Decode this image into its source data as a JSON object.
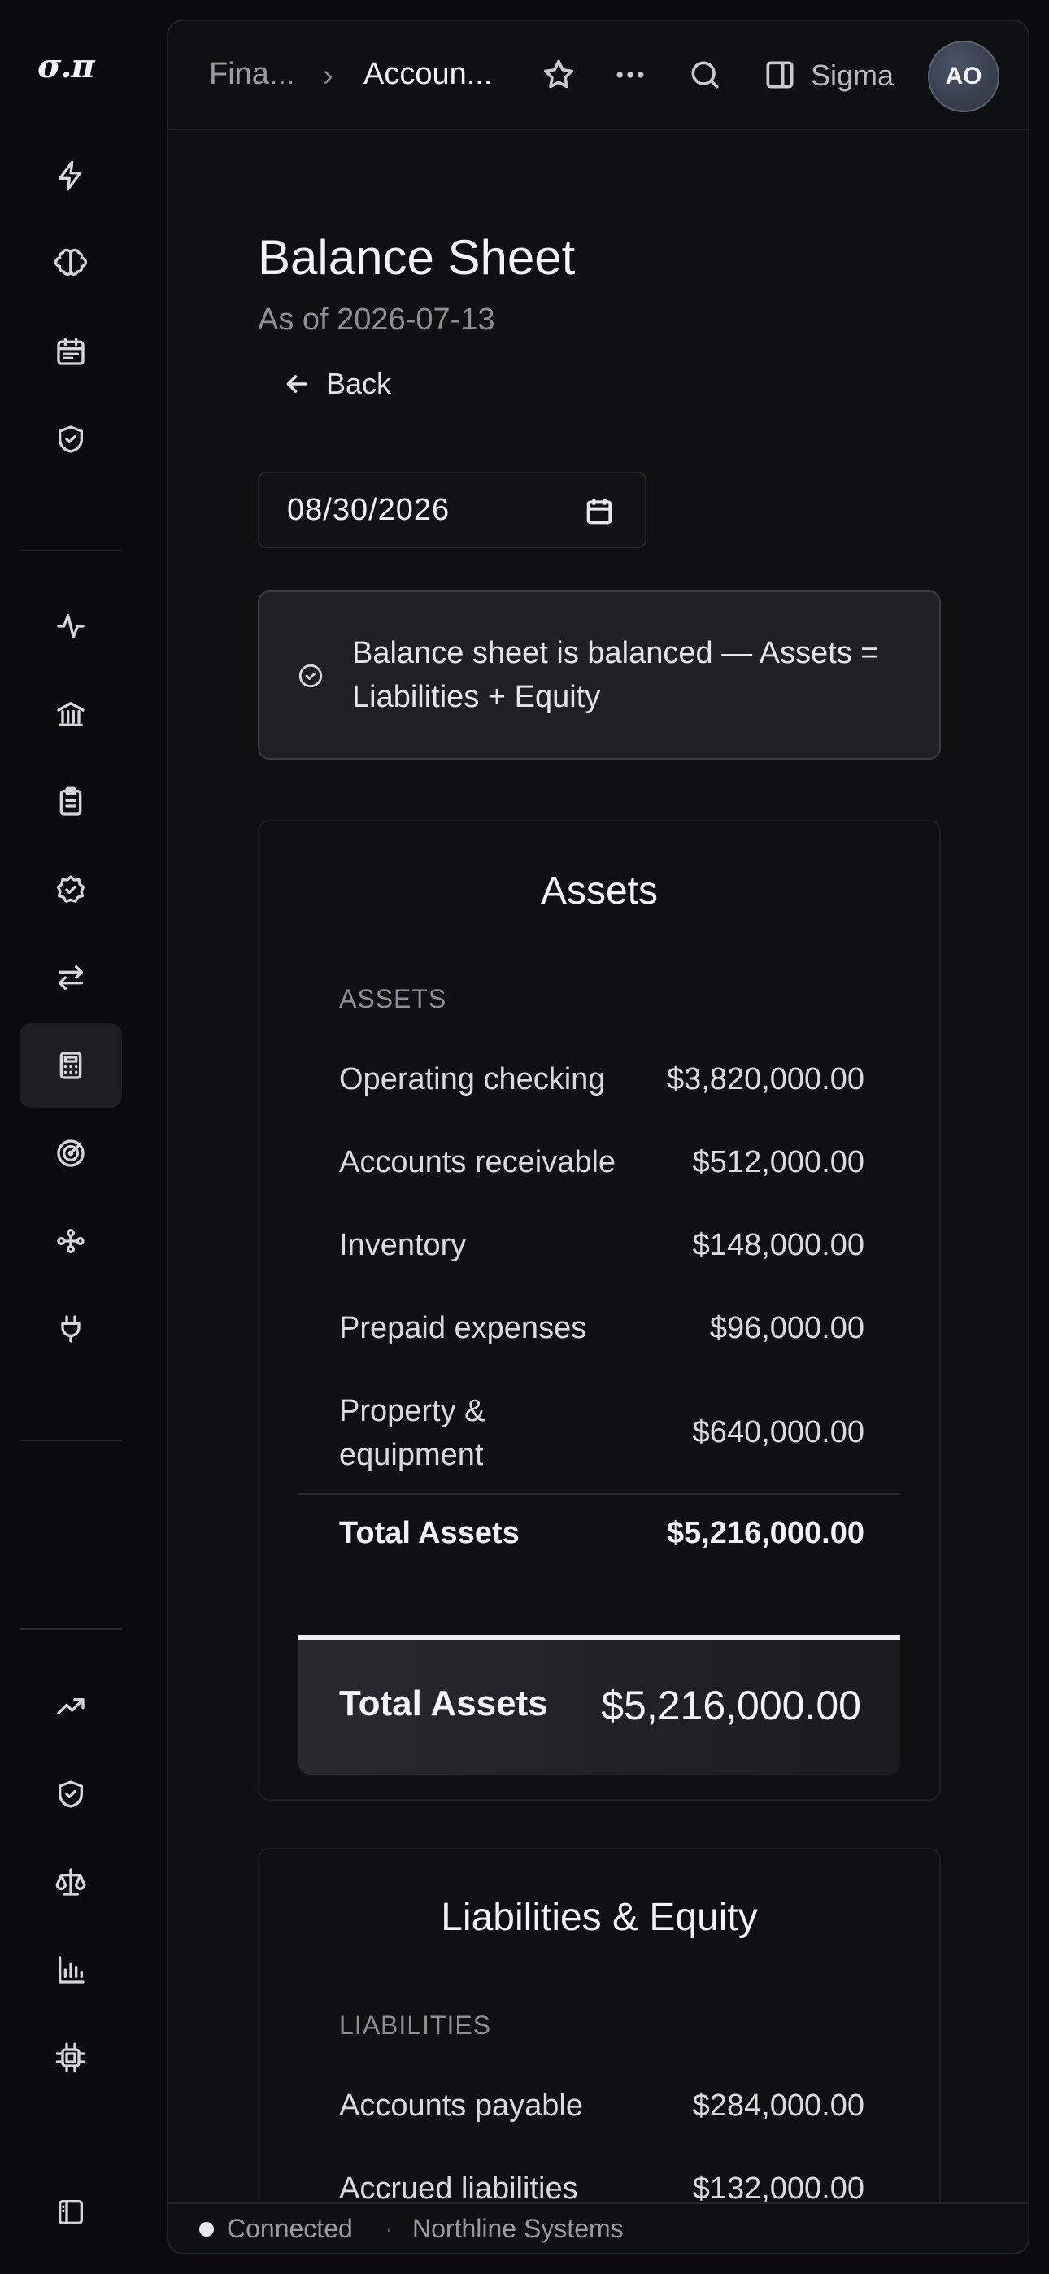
{
  "app": {
    "logo": "σ.π"
  },
  "topbar": {
    "breadcrumb_parent": "Fina...",
    "breadcrumb_sep": "›",
    "breadcrumb_current": "Accoun...",
    "workspace": "Sigma",
    "avatar_initials": "AO"
  },
  "page": {
    "title": "Balance Sheet",
    "subtitle": "As of 2026-07-13",
    "back_label": "Back",
    "date_value": "08/30/2026"
  },
  "alert": {
    "text": "Balance sheet is balanced — Assets = Liabilities + Equity"
  },
  "assets": {
    "title": "Assets",
    "section_label": "ASSETS",
    "rows": [
      {
        "label": "Operating checking",
        "value": "$3,820,000.00"
      },
      {
        "label": "Accounts receivable",
        "value": "$512,000.00"
      },
      {
        "label": "Inventory",
        "value": "$148,000.00"
      },
      {
        "label": "Prepaid expenses",
        "value": "$96,000.00"
      },
      {
        "label": "Property & equipment",
        "value": "$640,000.00"
      }
    ],
    "total_label": "Total Assets",
    "total_value": "$5,216,000.00",
    "grand_label": "Total Assets",
    "grand_value": "$5,216,000.00"
  },
  "liabilities": {
    "title": "Liabilities & Equity",
    "section_label": "LIABILITIES",
    "rows": [
      {
        "label": "Accounts payable",
        "value": "$284,000.00"
      },
      {
        "label": "Accrued liabilities",
        "value": "$132,000.00"
      }
    ]
  },
  "status": {
    "connection": "Connected",
    "separator": "·",
    "organization": "Northline Systems"
  },
  "colors": {
    "background": "#0b0b0d",
    "panel": "#0f1012",
    "alert_bg": "#1f2024",
    "text_primary": "#f4f4f6",
    "text_muted": "#8e8e96"
  },
  "icons": {
    "rail": [
      "bolt-icon",
      "brain-icon",
      "calendar-icon",
      "shield-check-icon",
      "activity-icon",
      "bank-icon",
      "clipboard-icon",
      "badge-check-icon",
      "arrows-left-right-icon",
      "calculator-icon",
      "target-icon",
      "workflow-icon",
      "plug-icon",
      "trending-up-icon",
      "shield-check-icon",
      "scale-icon",
      "bar-chart-icon",
      "chip-icon",
      "sidebar-toggle-icon"
    ]
  }
}
